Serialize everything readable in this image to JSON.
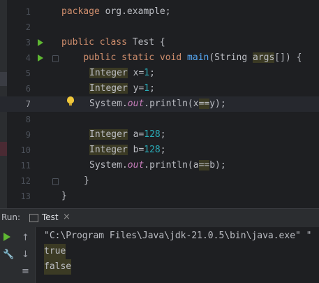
{
  "editor": {
    "line_numbers": [
      "1",
      "2",
      "3",
      "4",
      "5",
      "6",
      "7",
      "8",
      "9",
      "10",
      "11",
      "12",
      "13"
    ],
    "line1": {
      "kw": "package",
      "rest": " org.example;"
    },
    "line3": {
      "kw1": "public",
      "kw2": "class",
      "rest": " Test {"
    },
    "line4": {
      "kw1": "public",
      "kw2": "static",
      "kw3": "void",
      "fn": "main",
      "p1": "(String ",
      "args": "args",
      "p2": "[]) {"
    },
    "line5": {
      "type": "Integer",
      "mid": " x=",
      "num": "1",
      "end": ";"
    },
    "line6": {
      "type": "Integer",
      "mid": " y=",
      "num": "1",
      "end": ";"
    },
    "line7": {
      "pre": "System.",
      "out": "out",
      "mid": ".println(x",
      "op": "==",
      "end": "y);"
    },
    "line9": {
      "type": "Integer",
      "mid": " a=",
      "num": "128",
      "end": ";"
    },
    "line10": {
      "type": "Integer",
      "mid": " b=",
      "num": "128",
      "end": ";"
    },
    "line11": {
      "pre": "System.",
      "out": "out",
      "mid": ".println(a",
      "op": "==",
      "end": "b);"
    },
    "line12": "}",
    "line13": "}"
  },
  "run_panel": {
    "label": "Run:",
    "tab_label": "Test",
    "tab_close": "×",
    "command": "\"C:\\Program Files\\Java\\jdk-21.0.5\\bin\\java.exe\" \"",
    "output": [
      "true",
      "false"
    ]
  },
  "icons": {
    "run": "run-icon",
    "up": "arrow-up-icon",
    "down": "arrow-down-icon",
    "wrench": "wrench-icon",
    "wrap": "soft-wrap-icon",
    "bulb": "lightbulb-icon"
  },
  "colors": {
    "background": "#1e1f22",
    "keyword": "#cf8e6d",
    "function": "#56a8f5",
    "number": "#2aacb8",
    "static_field": "#c77dbb",
    "highlight": "#3b3a24",
    "run_green": "#5fb832"
  }
}
